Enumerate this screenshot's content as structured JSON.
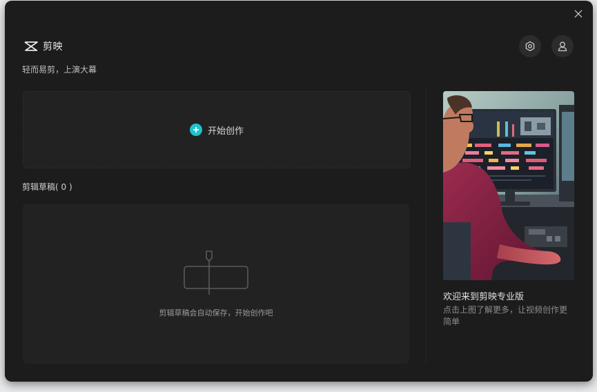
{
  "app": {
    "name": "剪映",
    "slogan": "轻而易剪，上演大幕"
  },
  "header": {
    "settings_icon": "hexagon-settings-icon",
    "account_icon": "user-icon",
    "close_icon": "close-icon"
  },
  "start": {
    "label": "开始创作",
    "icon": "plus-circle-icon",
    "accent": "#1fc2cf"
  },
  "drafts": {
    "heading": "剪辑草稿( 0 )",
    "empty_text": "剪辑草稿会自动保存，开始创作吧",
    "empty_icon": "timeline-clip-icon"
  },
  "promo": {
    "title": "欢迎来到剪映专业版",
    "description": "点击上图了解更多，让视频创作更简单"
  }
}
